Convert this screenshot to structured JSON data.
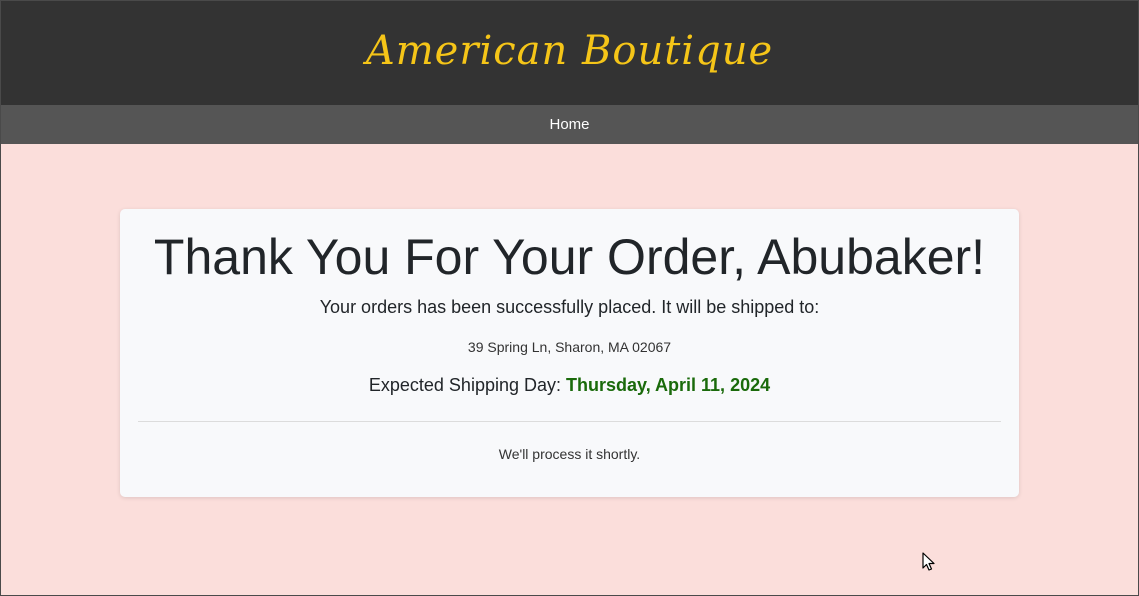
{
  "header": {
    "brand": "American Boutique"
  },
  "nav": {
    "home_label": "Home"
  },
  "confirmation": {
    "title": "Thank You For Your Order, Abubaker!",
    "subtitle": "Your orders has been successfully placed. It will be shipped to:",
    "address": "39 Spring Ln, Sharon, MA 02067",
    "shipping_label": "Expected Shipping Day:",
    "shipping_date": "Thursday, April 11, 2024",
    "note": "We'll process it shortly."
  },
  "colors": {
    "header_bg": "#333333",
    "nav_bg": "#555555",
    "brand": "#f5c518",
    "page_bg": "#fbdedb",
    "card_bg": "#f8f9fb",
    "shipping_date": "#1a6a0b"
  },
  "icons": {
    "cursor": "mouse-pointer-icon"
  }
}
